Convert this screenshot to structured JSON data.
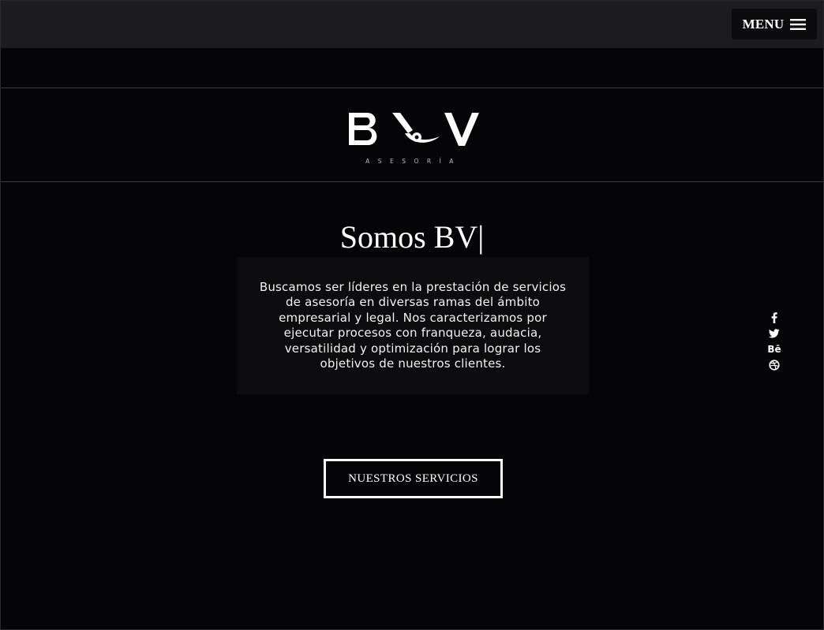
{
  "header": {
    "menu_label": "MENU",
    "menu_icon": "hamburger-icon"
  },
  "logo": {
    "wordmark": "BV",
    "tagline": "ASESORÍA"
  },
  "hero": {
    "title": "Somos BV|",
    "description": "Buscamos ser líderes en la prestación de servicios de asesoría en diversas ramas del ámbito empresarial y legal.  Nos caracterizamos por ejecutar procesos con  franqueza, audacia, versatilidad y optimización para lograr los objetivos de nuestros clientes.",
    "cta_label": "NUESTROS SERVICIOS"
  },
  "social": {
    "items": [
      {
        "icon": "facebook-icon"
      },
      {
        "icon": "twitter-icon"
      },
      {
        "icon": "behance-icon",
        "glyph": "Bē"
      },
      {
        "icon": "dribbble-icon"
      }
    ]
  },
  "colors": {
    "background": "#050507",
    "topbar": "#1c1c1e",
    "text": "#ffffff",
    "desc_box": "#0c0c0e"
  }
}
